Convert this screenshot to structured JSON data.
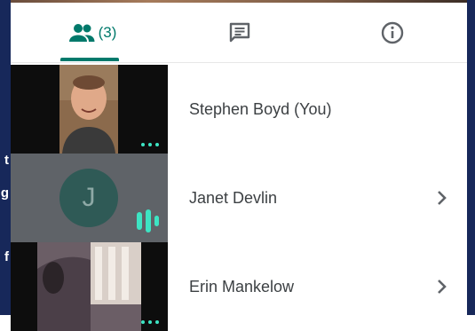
{
  "sidebar_fragments": [
    "t",
    "g",
    "f"
  ],
  "tabs": {
    "people_count": "(3)",
    "active": "people",
    "accent": "#00796b"
  },
  "participants": [
    {
      "name": "Stephen Boyd (You)",
      "tile": "video",
      "has_menu": false
    },
    {
      "name": "Janet Devlin",
      "tile": "avatar",
      "avatar_letter": "J",
      "speaking": true,
      "has_menu": true
    },
    {
      "name": "Erin Mankelow",
      "tile": "video",
      "has_menu": true
    }
  ],
  "colors": {
    "sidebar_navy": "#17285a",
    "speaking_teal": "#3de4c3",
    "avatar_bg": "#2f5a56",
    "tile_gray": "#5f6368"
  }
}
